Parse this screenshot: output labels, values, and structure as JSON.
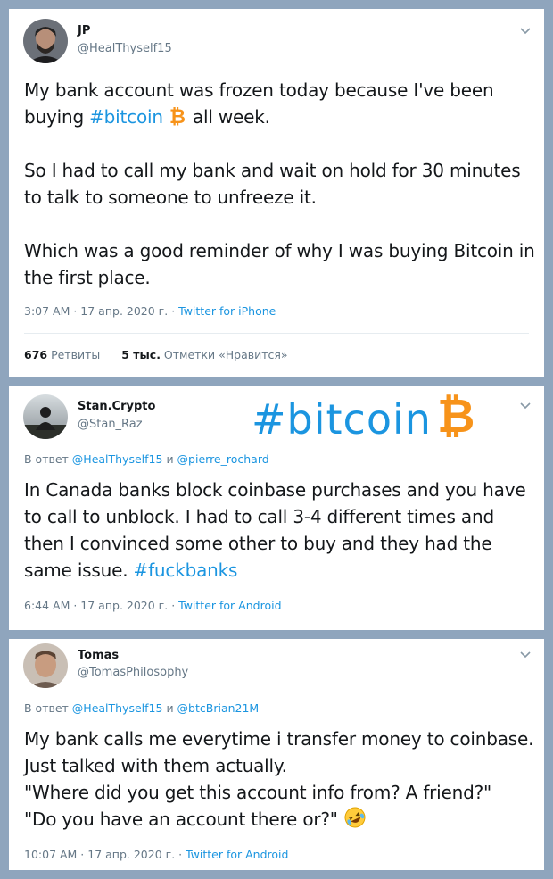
{
  "tweets": [
    {
      "name": "JP",
      "handle": "@HealThyself15",
      "text_pre": "My bank account was frozen today because I've been buying ",
      "hashtag": "#bitcoin",
      "text_post": " all week.\n\nSo I had to call my bank and wait on hold for 30 minutes to talk to someone to unfreeze it.\n\nWhich was a good reminder of why I was buying Bitcoin in the first place.",
      "time": "3:07 AM · 17 апр. 2020 г. · ",
      "source": "Twitter for iPhone",
      "retweets_count": "676",
      "retweets_label": " Ретвиты",
      "likes_count": "5 тыс.",
      "likes_label": " Отметки «Нравится»"
    },
    {
      "name": "Stan.Crypto",
      "handle": "@Stan_Raz",
      "overlay_tag": "#bitcoin",
      "reply_prefix": "В ответ ",
      "reply_to_1": "@HealThyself15",
      "reply_and": " и ",
      "reply_to_2": "@pierre_rochard",
      "text_pre": "In Canada banks block coinbase purchases and you have to call to unblock. I had to call 3-4 different times and then I convinced some other to buy and they had the same issue. ",
      "hashtag": "#fuckbanks",
      "time": "6:44 AM · 17 апр. 2020 г. · ",
      "source": "Twitter for Android"
    },
    {
      "name": "Tomas",
      "handle": "@TomasPhilosophy",
      "reply_prefix": "В ответ ",
      "reply_to_1": "@HealThyself15",
      "reply_and": " и ",
      "reply_to_2": "@btcBrian21M",
      "text": "My bank calls me everytime i transfer money to coinbase. Just talked with them actually.\n\"Where did you get this account info from? A friend?\"\n\"Do you have an account there or?\" ",
      "time": "10:07 AM · 17 апр. 2020 г. · ",
      "source": "Twitter for Android"
    }
  ],
  "colors": {
    "link": "#1b95e0",
    "muted": "#657786",
    "bitcoin": "#f7931a",
    "background": "#8fa5bd"
  },
  "icons": [
    "avatar-photo",
    "chevron-down-icon",
    "bitcoin-icon",
    "rolling-laughing-emoji"
  ]
}
